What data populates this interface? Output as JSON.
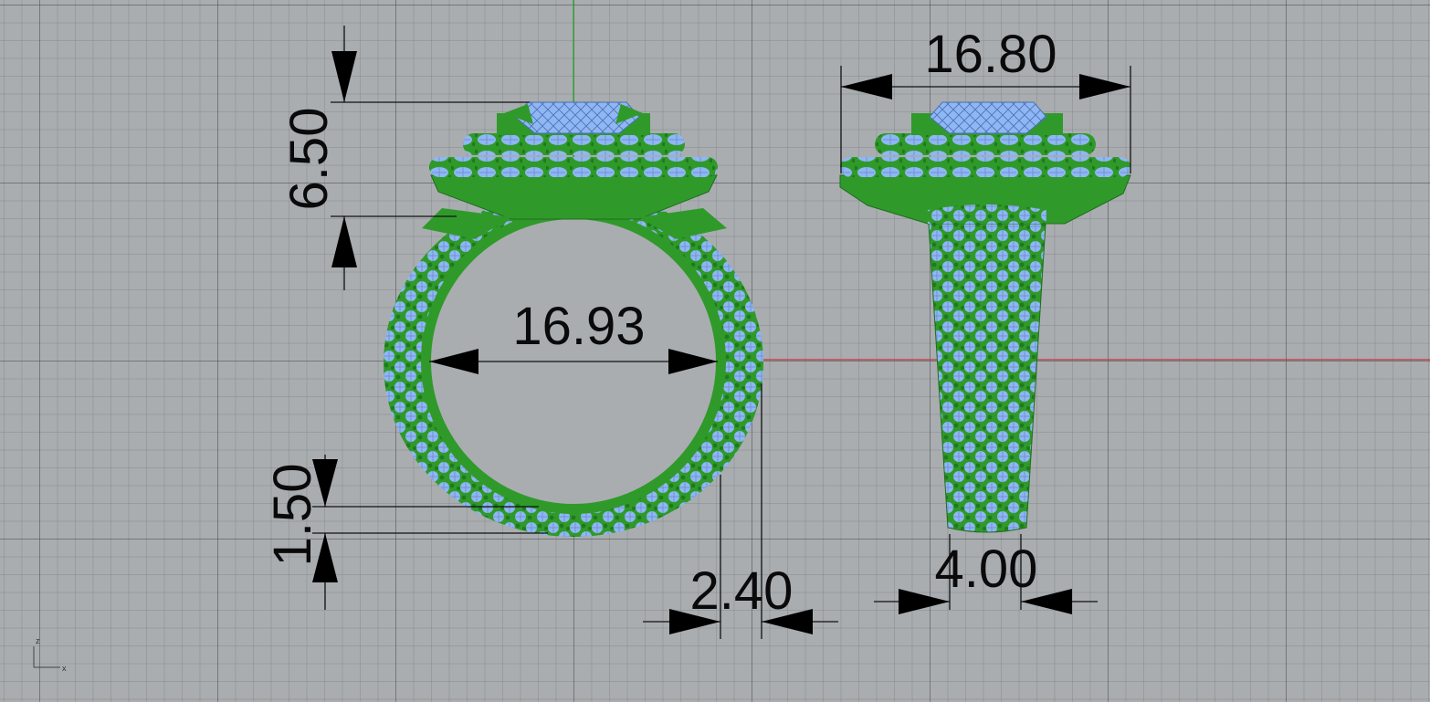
{
  "dimensions": {
    "top_width": "16.80",
    "head_height": "6.50",
    "inner_diameter": "16.93",
    "shank_thickness": "1.50",
    "shank_width_side": "2.40",
    "shank_width_bottom": "4.00"
  },
  "axis_widget": {
    "z_label": "z",
    "x_label": "x"
  },
  "colors": {
    "background": "#a9adb0",
    "metal": "#2f9a2a",
    "metal_dark": "#1f6d1c",
    "stone": "#8fb7f3",
    "stone_edge": "#5f86c8",
    "y_axis": "#2aa52a",
    "x_axis": "#c8373b"
  }
}
